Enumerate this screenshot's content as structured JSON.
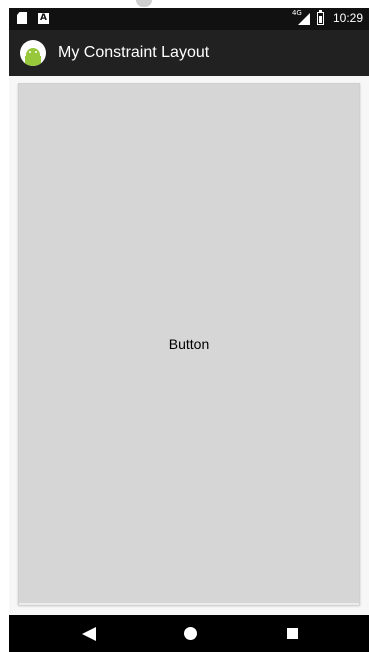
{
  "status_bar": {
    "time": "10:29",
    "network_type": "4G",
    "letter_icon": "A",
    "icons": [
      "sd-card-icon",
      "text-notification-icon",
      "signal-icon",
      "battery-icon"
    ]
  },
  "app_bar": {
    "title": "My Constraint Layout",
    "icon": "android-icon"
  },
  "main": {
    "button_label": "Button"
  },
  "navigation": {
    "icons": [
      "back-icon",
      "home-icon",
      "recents-icon"
    ]
  },
  "colors": {
    "status_bar": "#111111",
    "app_bar": "#212121",
    "content_background": "#f7f7f7",
    "button_background": "#d6d6d6",
    "android_green": "#97c83c",
    "navigation_bar": "#000000"
  }
}
